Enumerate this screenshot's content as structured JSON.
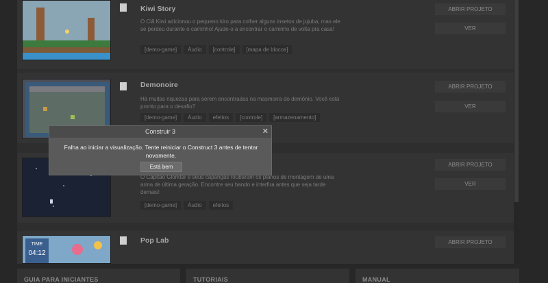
{
  "projects": [
    {
      "title": "Kiwi Story",
      "desc": "O Clã Kiwi adicionou o pequeno kiro para colher alguns insetos de jujuba, mas ele se perdeu durante o caminho! Ajude-o a encontrar o caminho de volta pra casa!",
      "tags": [
        "[demo-game]",
        "Áudio",
        "[controle]",
        "[mapa de blocos]"
      ],
      "open_label": "ABRIR PROJETO",
      "view_label": "VER"
    },
    {
      "title": "Demonoire",
      "desc": "Há muitas riquezas para serem encontradas na masmorra do demônio. Você está pronto para o desafio?",
      "tags": [
        "[demo-game]",
        "Áudio",
        "efeitos",
        "[controle]",
        "[armazenamento]"
      ],
      "open_label": "ABRIR PROJETO",
      "view_label": "VER"
    },
    {
      "title": "",
      "desc": "O Capitão Glorktar e seus capangas roubaram os planos de montagem de uma arma de última geração. Encontre seu bando e interfira antes que seja tarde demais!",
      "tags": [
        "[demo-game]",
        "Áudio",
        "efeitos"
      ],
      "open_label": "ABRIR PROJETO",
      "view_label": "VER"
    },
    {
      "title": "Pop Lab",
      "open_label": "ABRIR PROJETO"
    }
  ],
  "thumbnails": {
    "pop_lab_time_label": "TIME",
    "pop_lab_time_value": "04:12"
  },
  "bottom_panels": [
    "GUIA PARA INICIANTES",
    "TUTORIAIS",
    "MANUAL"
  ],
  "dialog": {
    "title": "Construir 3",
    "close": "✕",
    "message": "Falha ao iniciar a visualização. Tente reiniciar o Construct 3 antes de tentar novamente.",
    "ok_label": "Está bem"
  },
  "colors": {
    "background": "#272727",
    "card": "#333333",
    "dialog": "#5a5a5a",
    "dialog_header": "#4b4b4b",
    "button": "#3a3a3a"
  }
}
